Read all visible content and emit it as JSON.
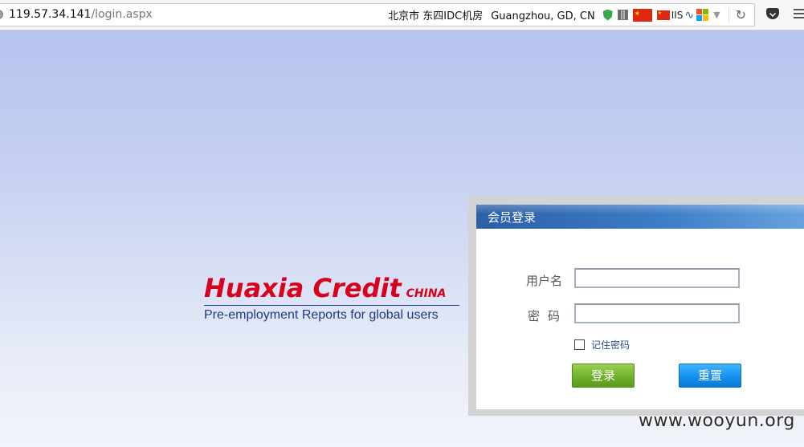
{
  "browser": {
    "url_host": "119.57.34.141",
    "url_path": "/login.aspx",
    "ip_city": "北京市 东四IDC机房",
    "ip_geo": "Guangzhou, GD, CN",
    "server_label": "IIS",
    "icons": [
      "globe-icon",
      "shield-icon",
      "qr-code-icon",
      "china-flag-icon",
      "china-flag-small-icon",
      "wave-icon",
      "windows-icon",
      "dropdown-caret-icon",
      "reload-icon",
      "pocket-icon",
      "menu-icon"
    ]
  },
  "logo": {
    "brand": "Huaxia Credit",
    "country": "CHINA",
    "tagline": "Pre-employment Reports for global users",
    "brand_color": "#d9001b",
    "tagline_color": "#1e3a86"
  },
  "login": {
    "title": "会员登录",
    "username_label": "用户名",
    "password_label": "密码",
    "username_value": "",
    "password_value": "",
    "remember_label": "记住密码",
    "remember_checked": false,
    "login_button": "登录",
    "reset_button": "重置"
  },
  "watermark": "www.wooyun.org"
}
